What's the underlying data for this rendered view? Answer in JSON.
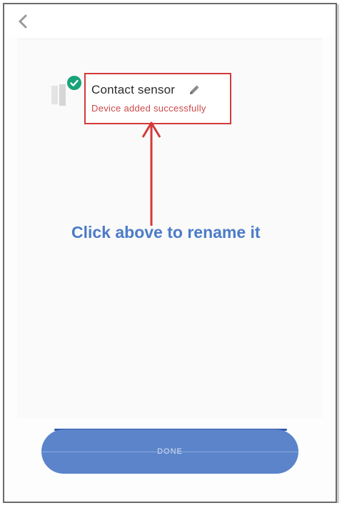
{
  "device": {
    "name": "Contact sensor",
    "status": "Device added successfully"
  },
  "instruction": "Click above to rename it",
  "button": {
    "label": "DONE"
  },
  "icons": {
    "back": "chevron-left-icon",
    "check": "check-circle-icon",
    "edit": "pencil-icon",
    "device": "contact-sensor-icon"
  },
  "colors": {
    "annotation_red": "#d33a3a",
    "success_green": "#18a37a",
    "instruction_blue": "#4b7bc8",
    "button_blue": "#5b84cb"
  }
}
